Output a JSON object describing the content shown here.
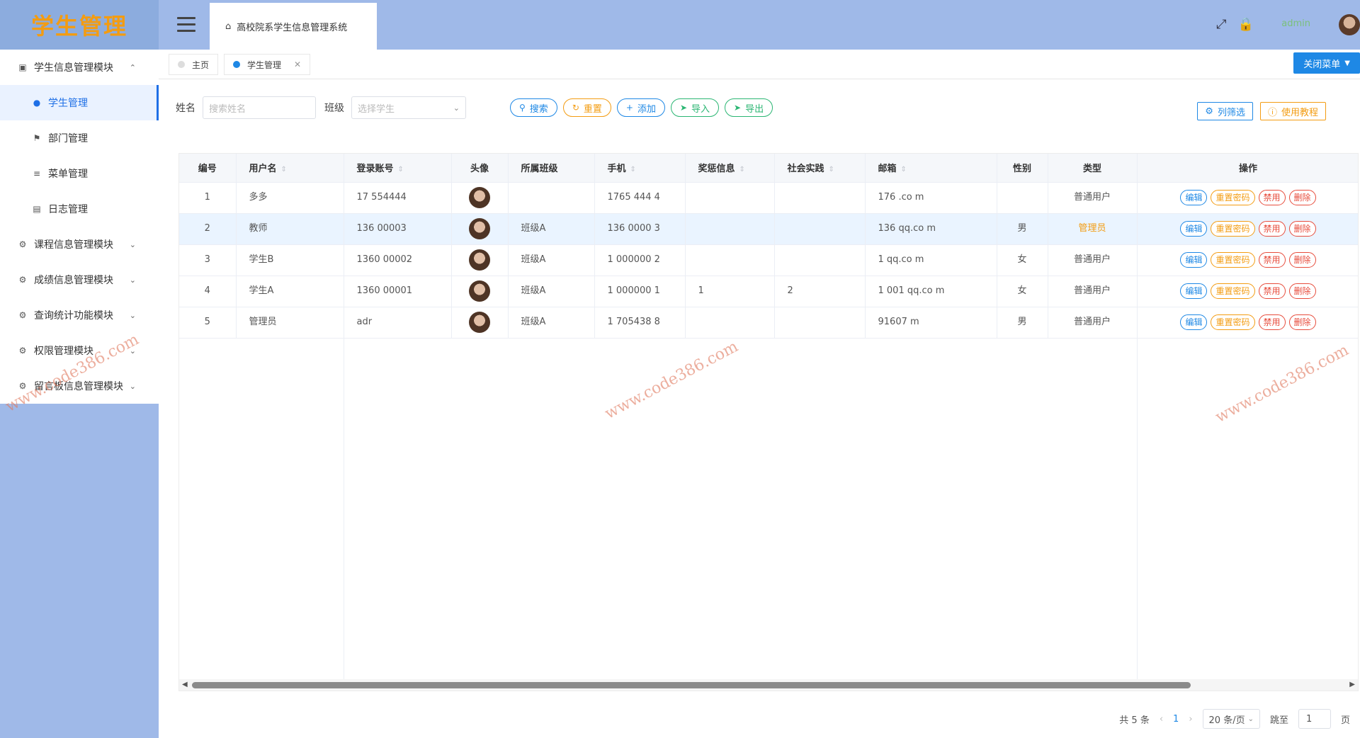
{
  "app": {
    "logo": "学生管理"
  },
  "header": {
    "system_title": "高校院系学生信息管理系统",
    "user_name": "admin"
  },
  "sidebar": {
    "items": [
      {
        "label": "学生信息管理模块",
        "chevron": "^"
      },
      {
        "label": "学生管理",
        "sub": true,
        "active": true
      },
      {
        "label": "部门管理",
        "sub": true
      },
      {
        "label": "菜单管理",
        "sub": true
      },
      {
        "label": "日志管理",
        "sub": true
      },
      {
        "label": "课程信息管理模块",
        "chevron": "v"
      },
      {
        "label": "成绩信息管理模块",
        "chevron": "v"
      },
      {
        "label": "查询统计功能模块",
        "chevron": "v"
      },
      {
        "label": "权限管理模块",
        "chevron": "v"
      },
      {
        "label": "留言板信息管理模块",
        "chevron": "v"
      }
    ]
  },
  "tabs": {
    "home": "主页",
    "current": "学生管理",
    "close_menu": "关闭菜单"
  },
  "filters": {
    "name_label": "姓名",
    "name_placeholder": "搜索姓名",
    "class_label": "班级",
    "class_placeholder": "选择学生",
    "search": "搜索",
    "reset": "重置",
    "add": "添加",
    "import": "导入",
    "export": "导出",
    "column_filter": "列筛选",
    "tutorial": "使用教程"
  },
  "table": {
    "headers": [
      "编号",
      "用户名",
      "登录账号",
      "头像",
      "所属班级",
      "手机",
      "奖惩信息",
      "社会实践",
      "邮箱",
      "性别",
      "类型",
      "操作"
    ],
    "rows": [
      {
        "id": "1",
        "username": "多多",
        "account": "17 554444",
        "class": "",
        "phone": "1765 444 4",
        "reward": "",
        "practice": "",
        "email": "176 .co m",
        "gender": "",
        "type": "普通用户"
      },
      {
        "id": "2",
        "username": "教师",
        "account": "136 00003",
        "class": "班级A",
        "phone": "136 0000 3",
        "reward": "",
        "practice": "",
        "email": "136 qq.co m",
        "gender": "男",
        "type": "管理员"
      },
      {
        "id": "3",
        "username": "学生B",
        "account": "1360 00002",
        "class": "班级A",
        "phone": "1 000000 2",
        "reward": "",
        "practice": "",
        "email": "1 qq.co m",
        "gender": "女",
        "type": "普通用户"
      },
      {
        "id": "4",
        "username": "学生A",
        "account": "1360 00001",
        "class": "班级A",
        "phone": "1 000000 1",
        "reward": "1",
        "practice": "2",
        "email": "1 001 qq.co m",
        "gender": "女",
        "type": "普通用户"
      },
      {
        "id": "5",
        "username": "管理员",
        "account": "adr",
        "class": "班级A",
        "phone": "1 705438 8",
        "reward": "",
        "practice": "",
        "email": "91607 m",
        "gender": "男",
        "type": "普通用户"
      }
    ],
    "ops": {
      "edit": "编辑",
      "reset_pwd": "重置密码",
      "ban": "禁用",
      "delete": "删除"
    }
  },
  "pager": {
    "total": "共 5 条",
    "current_page": "1",
    "page_size": "20 条/页",
    "goto_label": "跳至",
    "goto_value": "1",
    "page_suffix": "页"
  },
  "watermark": "www.code386.com",
  "colors": {
    "accent": "#1e88e5",
    "warning": "#f39c12",
    "danger": "#e74c3c",
    "success": "#2bb673",
    "sidebar": "#9fb9e8"
  },
  "icons": {
    "menu_toggle": "hamburger-icon",
    "home": "home-icon",
    "fullscreen": "fullscreen-icon",
    "lock": "lock-icon",
    "search": "search-icon",
    "reset": "refresh-icon",
    "add": "plus-icon",
    "import": "send-icon",
    "export": "send-icon",
    "settings": "gear-icon",
    "help": "info-icon"
  }
}
